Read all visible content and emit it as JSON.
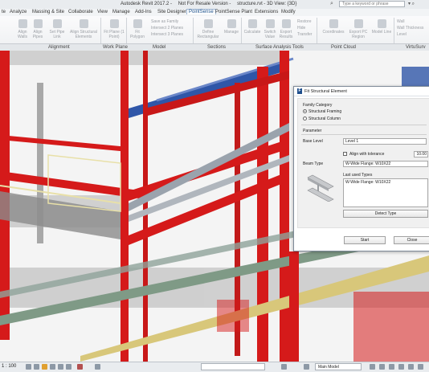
{
  "titlebar": {
    "title_parts": [
      "Autodesk Revit 2017.2 -",
      "Not For Resale Version -",
      "structure.rvt - 3D View: {3D}"
    ],
    "search_placeholder": "Type a keyword or phrase"
  },
  "menu": {
    "tabs": [
      "te",
      "Analyze",
      "Massing & Site",
      "Collaborate",
      "View",
      "Manage",
      "Add-Ins",
      "Site Designer",
      "PointSense",
      "PointSense Plant",
      "Extensions",
      "Modify"
    ],
    "active": "PointSense"
  },
  "ribbon": {
    "buttons": [
      "Align Walls",
      "Align Pipes",
      "Set Pipe Link",
      "Align Structural Elements",
      "Fit Plane (1 Point)",
      "Fit Polygon",
      "Define Rectangular",
      "Manage",
      "Calculate",
      "Switch Value",
      "Export Results",
      "Coordinates",
      "Export PC Region",
      "Model Line"
    ],
    "small_items": [
      "Intersect 2 Planes",
      "Intersect 3 Planes",
      "Save as Family",
      "Restore",
      "Hide",
      "Transfer",
      "Wall",
      "Wall Thickness",
      "Level"
    ],
    "panels": [
      "Alignment",
      "Work Plane",
      "Model",
      "Sections",
      "Surface Analysis Tools",
      "Point Cloud",
      "VirtuSurv"
    ]
  },
  "dialog": {
    "title": "Fit Structural Element",
    "family_category_label": "Family Category",
    "option_framing": "Structural Framing",
    "option_column": "Structural Column",
    "parameter_label": "Parameter",
    "base_level_label": "Base Level",
    "base_level_value": "Level 1",
    "align_tolerance_label": "Align with tolerance",
    "tolerance_value": "10.00",
    "beam_type_label": "Beam Type",
    "beam_type_value": "W-Wide Flange: W10X22",
    "last_used_label": "Last used Types",
    "last_used_items": [
      "W-Wide Flange: W10X22"
    ],
    "detect_button": "Detect Type",
    "start_button": "Start",
    "close_button": "Close"
  },
  "statusbar": {
    "scale": "1 : 100",
    "model": "Main Model"
  },
  "colors": {
    "steel_red": "#d51a1a",
    "pipe_blue": "#2f56a8",
    "pipe_yellow": "#d8c77a",
    "pipe_green": "#7f9a86"
  }
}
